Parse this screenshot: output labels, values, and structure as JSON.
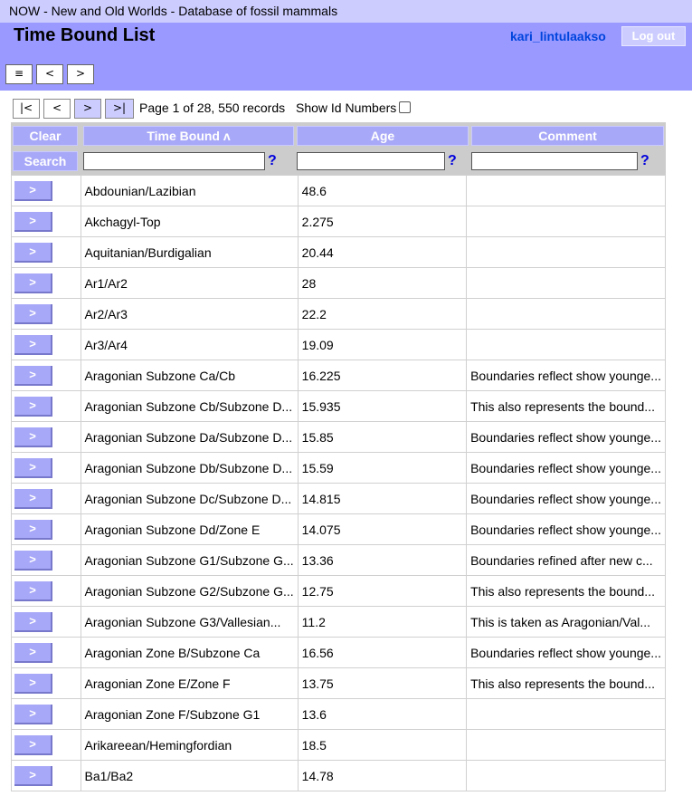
{
  "window_title": "NOW - New and Old Worlds - Database of fossil mammals",
  "page_title": "Time Bound List",
  "user": {
    "name": "kari_lintulaakso",
    "logout_label": "Log out"
  },
  "header_nav": [
    "≡",
    "<",
    ">"
  ],
  "pager": {
    "first": "|<",
    "prev": "<",
    "next": ">",
    "last": ">|",
    "status": "Page 1 of 28, 550 records",
    "show_id_label": "Show Id Numbers"
  },
  "columns": {
    "clear_label": "Clear",
    "search_label": "Search",
    "time_bound": "Time Bound ʌ",
    "age": "Age",
    "comment": "Comment",
    "help": "?"
  },
  "row_button_label": ">",
  "rows": [
    {
      "bound": "Abdounian/Lazibian",
      "age": "48.6",
      "comment": ""
    },
    {
      "bound": "Akchagyl-Top",
      "age": "2.275",
      "comment": ""
    },
    {
      "bound": "Aquitanian/Burdigalian",
      "age": "20.44",
      "comment": ""
    },
    {
      "bound": "Ar1/Ar2",
      "age": "28",
      "comment": ""
    },
    {
      "bound": "Ar2/Ar3",
      "age": "22.2",
      "comment": ""
    },
    {
      "bound": "Ar3/Ar4",
      "age": "19.09",
      "comment": ""
    },
    {
      "bound": "Aragonian Subzone Ca/Cb",
      "age": "16.225",
      "comment": "Boundaries reflect show younge..."
    },
    {
      "bound": "Aragonian Subzone Cb/Subzone D...",
      "age": "15.935",
      "comment": "This also represents the bound..."
    },
    {
      "bound": "Aragonian Subzone Da/Subzone D...",
      "age": "15.85",
      "comment": "Boundaries reflect show younge..."
    },
    {
      "bound": "Aragonian Subzone Db/Subzone D...",
      "age": "15.59",
      "comment": "Boundaries reflect show younge..."
    },
    {
      "bound": "Aragonian Subzone Dc/Subzone D...",
      "age": "14.815",
      "comment": "Boundaries reflect show younge..."
    },
    {
      "bound": "Aragonian Subzone Dd/Zone E",
      "age": "14.075",
      "comment": "Boundaries reflect show younge..."
    },
    {
      "bound": "Aragonian Subzone G1/Subzone G...",
      "age": "13.36",
      "comment": "Boundaries refined after new c..."
    },
    {
      "bound": "Aragonian Subzone G2/Subzone G...",
      "age": "12.75",
      "comment": "This also represents the bound..."
    },
    {
      "bound": "Aragonian Subzone G3/Vallesian...",
      "age": "11.2",
      "comment": "This is taken as Aragonian/Val..."
    },
    {
      "bound": "Aragonian Zone B/Subzone Ca",
      "age": "16.56",
      "comment": "Boundaries reflect show younge..."
    },
    {
      "bound": "Aragonian Zone E/Zone F",
      "age": "13.75",
      "comment": "This also represents the bound..."
    },
    {
      "bound": "Aragonian Zone F/Subzone G1",
      "age": "13.6",
      "comment": ""
    },
    {
      "bound": "Arikareean/Hemingfordian",
      "age": "18.5",
      "comment": ""
    },
    {
      "bound": "Ba1/Ba2",
      "age": "14.78",
      "comment": ""
    }
  ]
}
